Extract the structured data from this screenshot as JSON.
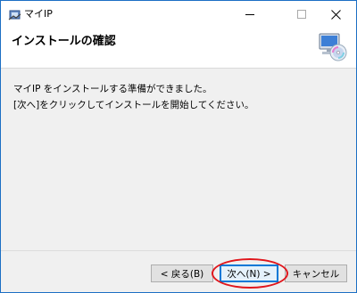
{
  "window": {
    "title": "マイIP",
    "controls": {
      "minimize": "—",
      "maximize": "☐",
      "close": "✕"
    }
  },
  "header": {
    "title": "インストールの確認"
  },
  "body": {
    "line1": "マイIP をインストールする準備ができました。",
    "line2": "[次へ]をクリックしてインストールを開始してください。"
  },
  "buttons": {
    "back": "< 戻る(B)",
    "next": "次へ(N) >",
    "cancel": "キャンセル"
  },
  "colors": {
    "accent": "#0078d7",
    "highlight": "#e0161c"
  }
}
